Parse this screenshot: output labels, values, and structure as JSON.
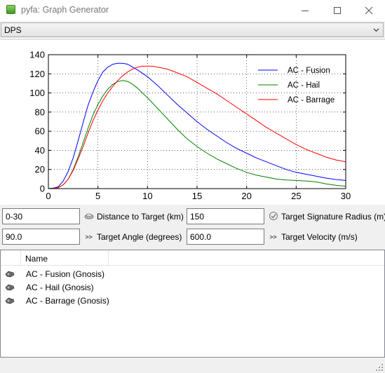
{
  "window": {
    "title": "pyfa: Graph Generator"
  },
  "graph_select": {
    "value": "DPS"
  },
  "chart_data": {
    "type": "line",
    "xlim": [
      0,
      30
    ],
    "ylim": [
      0,
      140
    ],
    "x_ticks": [
      0,
      5,
      10,
      15,
      20,
      25,
      30
    ],
    "y_ticks": [
      0,
      20,
      40,
      60,
      80,
      100,
      120,
      140
    ],
    "grid": true,
    "legend_position": "top-right",
    "series": [
      {
        "name": "AC - Fusion",
        "color": "#0000ff",
        "x": [
          0,
          0.5,
          1,
          1.5,
          2,
          2.5,
          3,
          3.5,
          4,
          4.5,
          5,
          5.5,
          6,
          6.5,
          7,
          7.5,
          8,
          8.5,
          9,
          10,
          11,
          12,
          13,
          14,
          15,
          16,
          17,
          18,
          19,
          20,
          21,
          22,
          23,
          24,
          25,
          26,
          27,
          28,
          29,
          30
        ],
        "y": [
          0,
          0.5,
          2,
          8,
          18,
          32,
          50,
          69,
          87,
          101,
          113,
          122,
          127,
          130,
          131,
          131,
          130,
          127,
          124,
          117,
          108,
          98,
          88,
          79,
          70,
          62,
          55,
          48,
          42,
          37,
          32,
          28,
          24,
          20,
          17,
          15,
          13,
          11,
          9.5,
          8.5
        ]
      },
      {
        "name": "AC - Hail",
        "color": "#008000",
        "x": [
          0,
          0.5,
          1,
          1.5,
          2,
          2.5,
          3,
          3.5,
          4,
          4.5,
          5,
          5.5,
          6,
          6.5,
          7,
          7.5,
          8,
          8.5,
          9,
          10,
          11,
          12,
          13,
          14,
          15,
          16,
          17,
          18,
          19,
          20,
          21,
          22,
          23,
          24,
          25,
          26,
          27,
          28,
          29,
          30
        ],
        "y": [
          0,
          0.3,
          1,
          4,
          10,
          20,
          33,
          48,
          63,
          77,
          88,
          97,
          104,
          109,
          112,
          113,
          112,
          109,
          105,
          95,
          84,
          73,
          62,
          52,
          44,
          37,
          31,
          26,
          21,
          17,
          14,
          12,
          10,
          9,
          8.5,
          8,
          7,
          5,
          3.5,
          2.5
        ]
      },
      {
        "name": "AC - Barrage",
        "color": "#ff0000",
        "x": [
          0,
          0.5,
          1,
          1.5,
          2,
          2.5,
          3,
          3.5,
          4,
          4.5,
          5,
          5.5,
          6,
          6.5,
          7,
          7.5,
          8,
          8.5,
          9,
          9.5,
          10,
          10.5,
          11,
          12,
          13,
          14,
          15,
          16,
          17,
          18,
          19,
          20,
          21,
          22,
          23,
          24,
          25,
          26,
          27,
          28,
          29,
          30
        ],
        "y": [
          0,
          0.3,
          1,
          4,
          10,
          19,
          31,
          44,
          58,
          71,
          82,
          92,
          100,
          107,
          113,
          118,
          122,
          125,
          127,
          128,
          128,
          128,
          127,
          125,
          121,
          117,
          111,
          105,
          99,
          92,
          85,
          78,
          71,
          64,
          58,
          52,
          46,
          41,
          37,
          33,
          30,
          28
        ]
      }
    ]
  },
  "fields": {
    "distance": {
      "value": "0-30",
      "label": "Distance to Target (km)"
    },
    "signature": {
      "value": "150",
      "label": "Target Signature Radius (m)"
    },
    "angle": {
      "value": "90.0",
      "label": "Target Angle (degrees)"
    },
    "velocity": {
      "value": "600.0",
      "label": "Target Velocity (m/s)"
    }
  },
  "fit_list": {
    "header": "Name",
    "rows": [
      "AC - Fusion (Gnosis)",
      "AC - Hail (Gnosis)",
      "AC - Barrage (Gnosis)"
    ]
  }
}
